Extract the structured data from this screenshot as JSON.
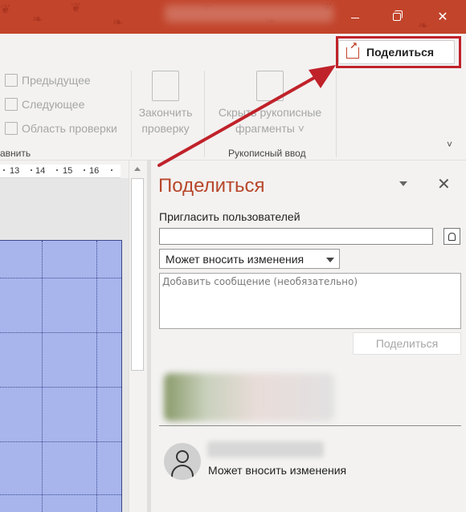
{
  "titlebar": {
    "minimize_icon": "minimize-icon",
    "restore_icon": "restore-icon",
    "close_glyph": "✕"
  },
  "ribbon": {
    "share_button": "Поделиться",
    "review_group": {
      "prev": "Предыдущее",
      "next": "Следующее",
      "review_pane": "Область проверки",
      "label_fragment": "авнить"
    },
    "finish_review": {
      "line1": "Закончить",
      "line2": "проверку"
    },
    "hide_ink": {
      "line1": "Скрыть рукописные",
      "line2": "фрагменты ˅"
    },
    "ink_group_label": "Рукописный ввод",
    "collapse_glyph": "˅"
  },
  "ruler": {
    "ticks": [
      "13",
      "14",
      "15",
      "16"
    ]
  },
  "share_pane": {
    "title": "Поделиться",
    "close_glyph": "✕",
    "invite_label": "Пригласить пользователей",
    "invite_value": "",
    "permission_selected": "Может вносить изменения",
    "message_placeholder": "Добавить сообщение (необязательно)",
    "share_button": "Поделиться",
    "shared_user_permission": "Может вносить изменения"
  },
  "colors": {
    "accent": "#c2442b",
    "highlight": "#c0222a",
    "pane_title": "#b7472a",
    "slide": "#a7b5ec"
  }
}
